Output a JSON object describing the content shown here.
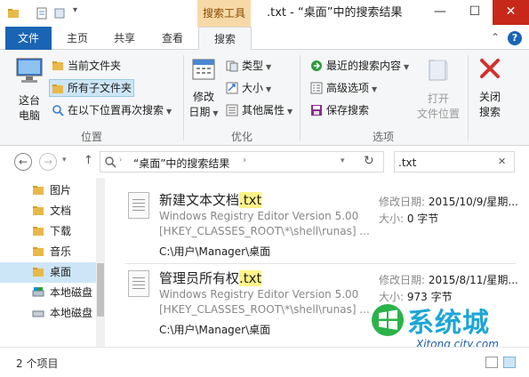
{
  "title_bar": {
    "context_tab": "搜索工具",
    "window_title": ".txt - “桌面”中的搜索结果",
    "minimize_glyph": "—",
    "maximize_glyph": "☐",
    "close_glyph": "✕",
    "qat_dropdown_glyph": "▾"
  },
  "tabs": [
    "文件",
    "主页",
    "共享",
    "查看",
    "搜索"
  ],
  "ribbon_side": {
    "collapse_glyph": "⌃",
    "help_glyph": "?"
  },
  "ribbon": {
    "location_group": {
      "label": "位置",
      "this_pc": "这台\n电脑",
      "current_folder": "当前文件夹",
      "all_subfolders": "所有子文件夹",
      "search_again": "在以下位置再次搜索"
    },
    "refine_group": {
      "label": "优化",
      "modified_date": "修改\n日期",
      "kind": "类型",
      "size": "大小",
      "other_props": "其他属性"
    },
    "options_group": {
      "label": "选项",
      "recent_searches": "最近的搜索内容",
      "advanced": "高级选项",
      "save_search": "保存搜索",
      "open_location": "打开\n文件位置",
      "close_search": "关闭\n搜索"
    }
  },
  "address_bar": {
    "back_glyph": "←",
    "forward_glyph": "→",
    "up_glyph": "↑",
    "location": "“桌面”中的搜索结果",
    "chevron": "›",
    "dropdown_glyph": "▾",
    "refresh_glyph": "↻",
    "search_value": ".txt",
    "clear_glyph": "✕"
  },
  "nav_items": [
    {
      "label": "图片",
      "icon": "folder-icon"
    },
    {
      "label": "文档",
      "icon": "folder-icon"
    },
    {
      "label": "下载",
      "icon": "folder-icon"
    },
    {
      "label": "音乐",
      "icon": "folder-icon"
    },
    {
      "label": "桌面",
      "icon": "folder-icon"
    },
    {
      "label": "本地磁盘",
      "icon": "drive-icon"
    },
    {
      "label": "本地磁盘",
      "icon": "drive-icon"
    }
  ],
  "results": [
    {
      "name_base": "新建文本文档",
      "name_ext": ".txt",
      "snippet1": "Windows Registry Editor Version 5.00",
      "snippet2": "[HKEY_CLASSES_ROOT\\*\\shell\\runas] ...",
      "path": "C:\\用户\\Manager\\桌面",
      "date_label": "修改日期: ",
      "date_value": "2015/10/9/星期...",
      "size_label": "大小: ",
      "size_value": "0 字节"
    },
    {
      "name_base": "管理员所有权",
      "name_ext": ".txt",
      "snippet1": "Windows Registry Editor Version 5.00",
      "snippet2": "[HKEY_CLASSES_ROOT\\*\\shell\\runas] ...",
      "path": "C:\\用户\\Manager\\桌面",
      "date_label": "修改日期: ",
      "date_value": "2015/8/11/星期...",
      "size_label": "大小: ",
      "size_value": "973 字节"
    }
  ],
  "status": {
    "count": "2 个项目"
  },
  "watermark": {
    "cn": "系统城",
    "en": "Xitong city.com"
  },
  "colors": {
    "file_tab": "#1a64b4",
    "context_tab": "#f7d9a8",
    "selection": "#cde6f7",
    "highlight": "#fff38a",
    "close_button": "#c7281a"
  }
}
